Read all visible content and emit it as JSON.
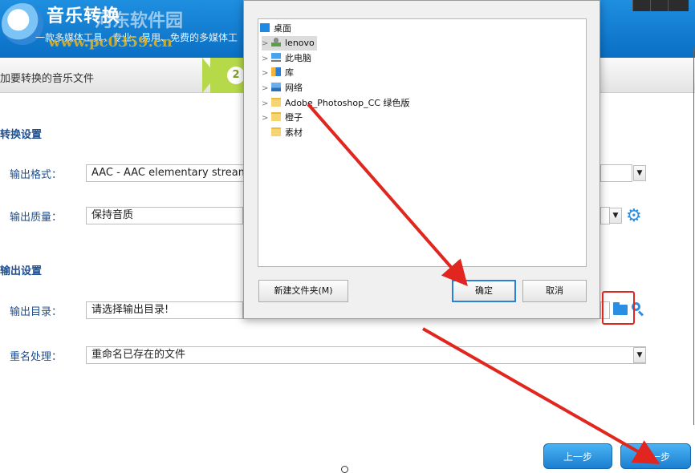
{
  "app": {
    "title": "音乐转换",
    "slogan": "一款多媒体工具，专业、易用、免费的多媒体工",
    "watermark_text": "河东软件园",
    "watermark_url": "www.pc0359.cn"
  },
  "steps": {
    "step1_label": "加要转换的音乐文件",
    "step2_number": "2"
  },
  "conversion_settings": {
    "title": "转换设置",
    "output_format_label": "输出格式：",
    "output_format_value": "AAC - AAC elementary stream (",
    "output_quality_label": "输出质量：",
    "output_quality_value": "保持音质"
  },
  "output_settings": {
    "title": "输出设置",
    "output_dir_label": "输出目录：",
    "output_dir_placeholder": "请选择输出目录!",
    "rename_label": "重名处理：",
    "rename_value": "重命名已存在的文件"
  },
  "navigation": {
    "prev_label": "上一步",
    "next_label": "下一步"
  },
  "folder_dialog": {
    "tree": [
      {
        "label": "桌面",
        "icon": "desktop-icon",
        "expandable": false,
        "indent": 0
      },
      {
        "label": "lenovo",
        "icon": "user-folder-icon",
        "expandable": true,
        "indent": 1,
        "selected": true
      },
      {
        "label": "此电脑",
        "icon": "computer-icon",
        "expandable": true,
        "indent": 1
      },
      {
        "label": "库",
        "icon": "library-icon",
        "expandable": true,
        "indent": 1
      },
      {
        "label": "网络",
        "icon": "network-icon",
        "expandable": true,
        "indent": 1
      },
      {
        "label": "Adobe_Photoshop_CC 绿色版",
        "icon": "folder-icon",
        "expandable": true,
        "indent": 1
      },
      {
        "label": "橙子",
        "icon": "folder-icon",
        "expandable": true,
        "indent": 1
      },
      {
        "label": "素材",
        "icon": "folder-icon",
        "expandable": false,
        "indent": 1
      }
    ],
    "new_folder_label": "新建文件夹(M)",
    "ok_label": "确定",
    "cancel_label": "取消"
  },
  "colors": {
    "header_blue": "#0a6fc4",
    "step_green": "#b6d94a",
    "label_blue": "#1d4f91",
    "annotation_red": "#e0261f",
    "accent_blue": "#2a8fe3"
  }
}
